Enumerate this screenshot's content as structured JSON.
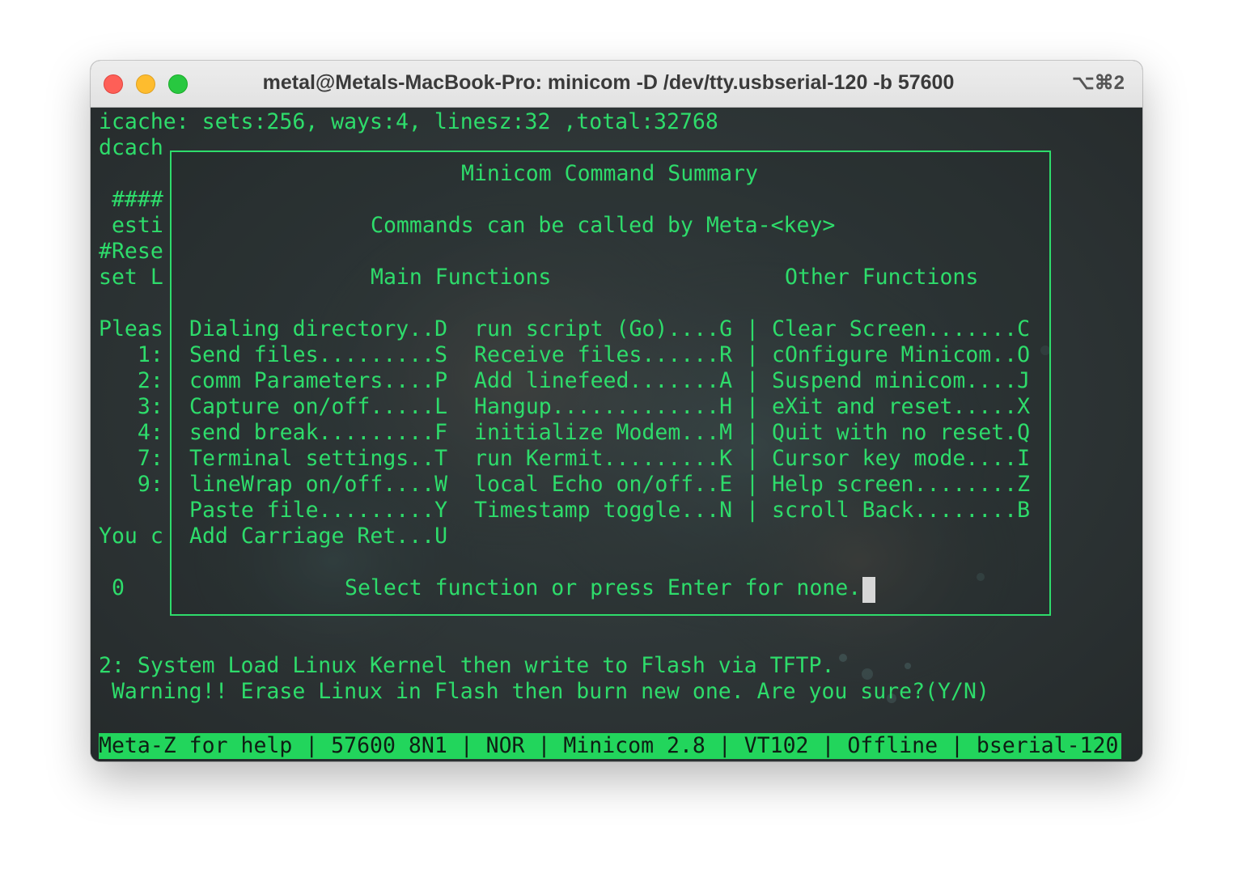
{
  "window": {
    "title": "metal@Metals-MacBook-Pro: minicom -D /dev/tty.usbserial-120 -b 57600",
    "shortcut": "⌥⌘2"
  },
  "terminal": {
    "line1": "icache: sets:256, ways:4, linesz:32 ,total:32768",
    "left_fragments": [
      "dcach",
      " ####",
      " esti",
      "#Rese",
      "set L",
      "Pleas",
      "   1:",
      "   2:",
      "   3:",
      "   4:",
      "   7:",
      "   9:",
      "You c",
      " 0"
    ],
    "line_after_1": "2: System Load Linux Kernel then write to Flash via TFTP.",
    "line_after_2": " Warning!! Erase Linux in Flash then burn new one. Are you sure?(Y/N)"
  },
  "popup": {
    "title": "Minicom Command Summary",
    "subtitle": "Commands can be called by Meta-<key>",
    "main_header": "Main Functions",
    "other_header": "Other Functions",
    "main_col1": [
      "Dialing directory..D",
      "Send files.........S",
      "comm Parameters....P",
      "Capture on/off.....L",
      "send break.........F",
      "Terminal settings..T",
      "lineWrap on/off....W",
      "Paste file.........Y",
      "Add Carriage Ret...U"
    ],
    "main_col2": [
      "run script (Go)....G",
      "Receive files......R",
      "Add linefeed.......A",
      "Hangup.............H",
      "initialize Modem...M",
      "run Kermit.........K",
      "local Echo on/off..E",
      "Timestamp toggle...N"
    ],
    "separator": "|",
    "other_col": [
      "Clear Screen.......C",
      "cOnfigure Minicom..O",
      "Suspend minicom....J",
      "eXit and reset.....X",
      "Quit with no reset.Q",
      "Cursor key mode....I",
      "Help screen........Z",
      "scroll Back........B"
    ],
    "prompt": "Select function or press Enter for none."
  },
  "statusbar": {
    "text": "Meta-Z for help | 57600 8N1 | NOR | Minicom 2.8 | VT102 | Offline | bserial-120"
  },
  "colors": {
    "text": "#2edc6b",
    "status_bg": "#22d55c",
    "background": "#2b3132"
  }
}
